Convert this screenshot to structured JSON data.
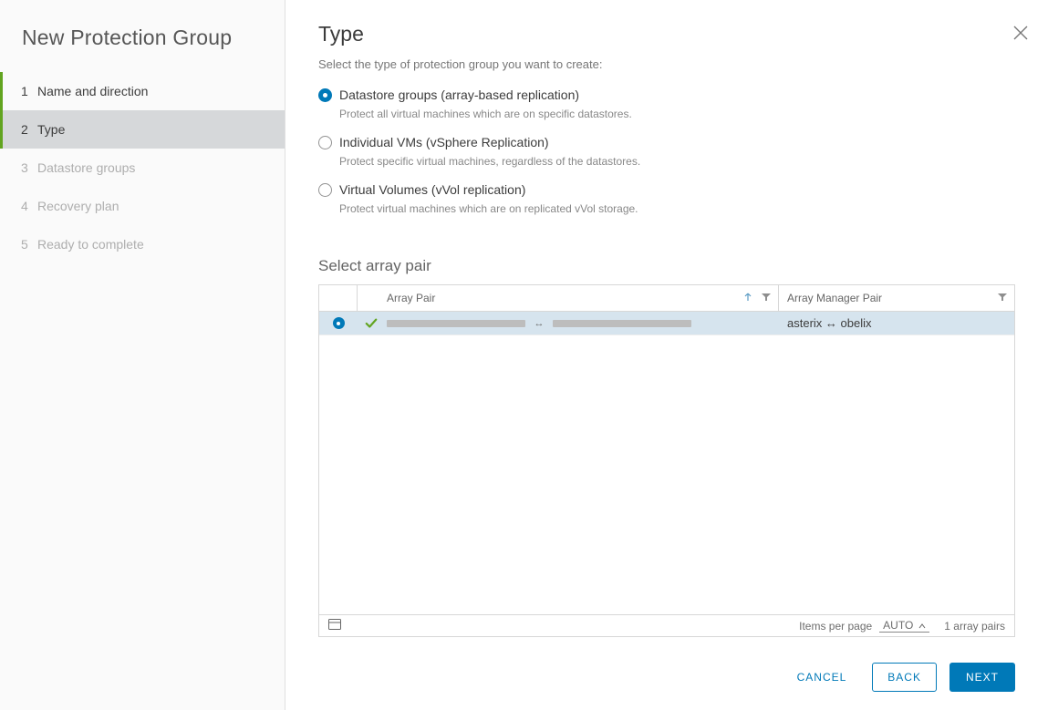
{
  "wizard": {
    "title": "New Protection Group",
    "steps": [
      {
        "number": "1",
        "label": "Name and direction",
        "state": "completed"
      },
      {
        "number": "2",
        "label": "Type",
        "state": "active"
      },
      {
        "number": "3",
        "label": "Datastore groups",
        "state": "upcoming"
      },
      {
        "number": "4",
        "label": "Recovery plan",
        "state": "upcoming"
      },
      {
        "number": "5",
        "label": "Ready to complete",
        "state": "upcoming"
      }
    ]
  },
  "main": {
    "title": "Type",
    "intro": "Select the type of protection group you want to create:",
    "options": [
      {
        "label": "Datastore groups (array-based replication)",
        "desc": "Protect all virtual machines which are on specific datastores.",
        "selected": true
      },
      {
        "label": "Individual VMs (vSphere Replication)",
        "desc": "Protect specific virtual machines, regardless of the datastores.",
        "selected": false
      },
      {
        "label": "Virtual Volumes (vVol replication)",
        "desc": "Protect virtual machines which are on replicated vVol storage.",
        "selected": false
      }
    ],
    "arraySection": {
      "title": "Select array pair",
      "columns": {
        "pair": "Array Pair",
        "manager": "Array Manager Pair"
      },
      "rows": [
        {
          "selected": true,
          "statusOk": true,
          "managerPair": "asterix ↔ obelix"
        }
      ],
      "footer": {
        "itemsPerPageLabel": "Items per page",
        "itemsPerPageValue": "AUTO",
        "rowsSummary": "1 array pairs"
      }
    }
  },
  "buttons": {
    "cancel": "CANCEL",
    "back": "BACK",
    "next": "NEXT"
  }
}
